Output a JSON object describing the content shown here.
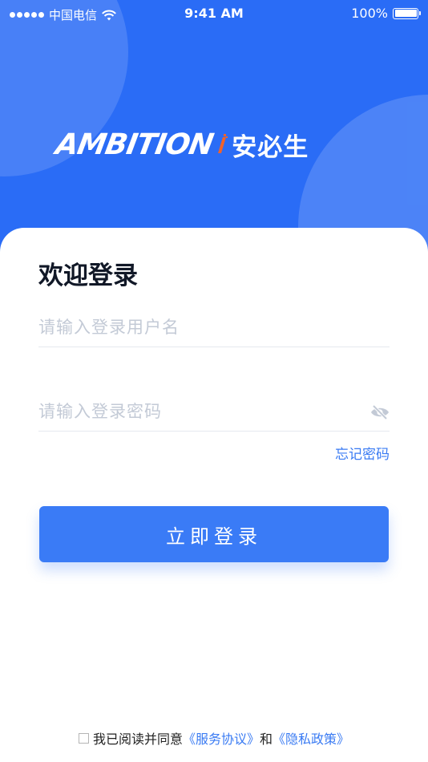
{
  "status_bar": {
    "carrier": "中国电信",
    "time": "9:41 AM",
    "battery": "100%"
  },
  "brand": {
    "logo_text": "AMBITION",
    "logo_cn": "安必生"
  },
  "login": {
    "title": "欢迎登录",
    "username_placeholder": "请输入登录用户名",
    "password_placeholder": "请输入登录密码",
    "forgot_label": "忘记密码",
    "submit_label": "立即登录"
  },
  "agreement": {
    "prefix": "我已阅读并同意",
    "service_link": "《服务协议》",
    "conjunction": "和",
    "privacy_link": "《隐私政策》"
  },
  "colors": {
    "primary": "#3a7bf6",
    "hero": "#2a6cf6",
    "accent": "#f0622b"
  },
  "icons": [
    "signal-dots-icon",
    "wifi-icon",
    "battery-icon",
    "eye-off-icon",
    "checkbox-icon"
  ]
}
